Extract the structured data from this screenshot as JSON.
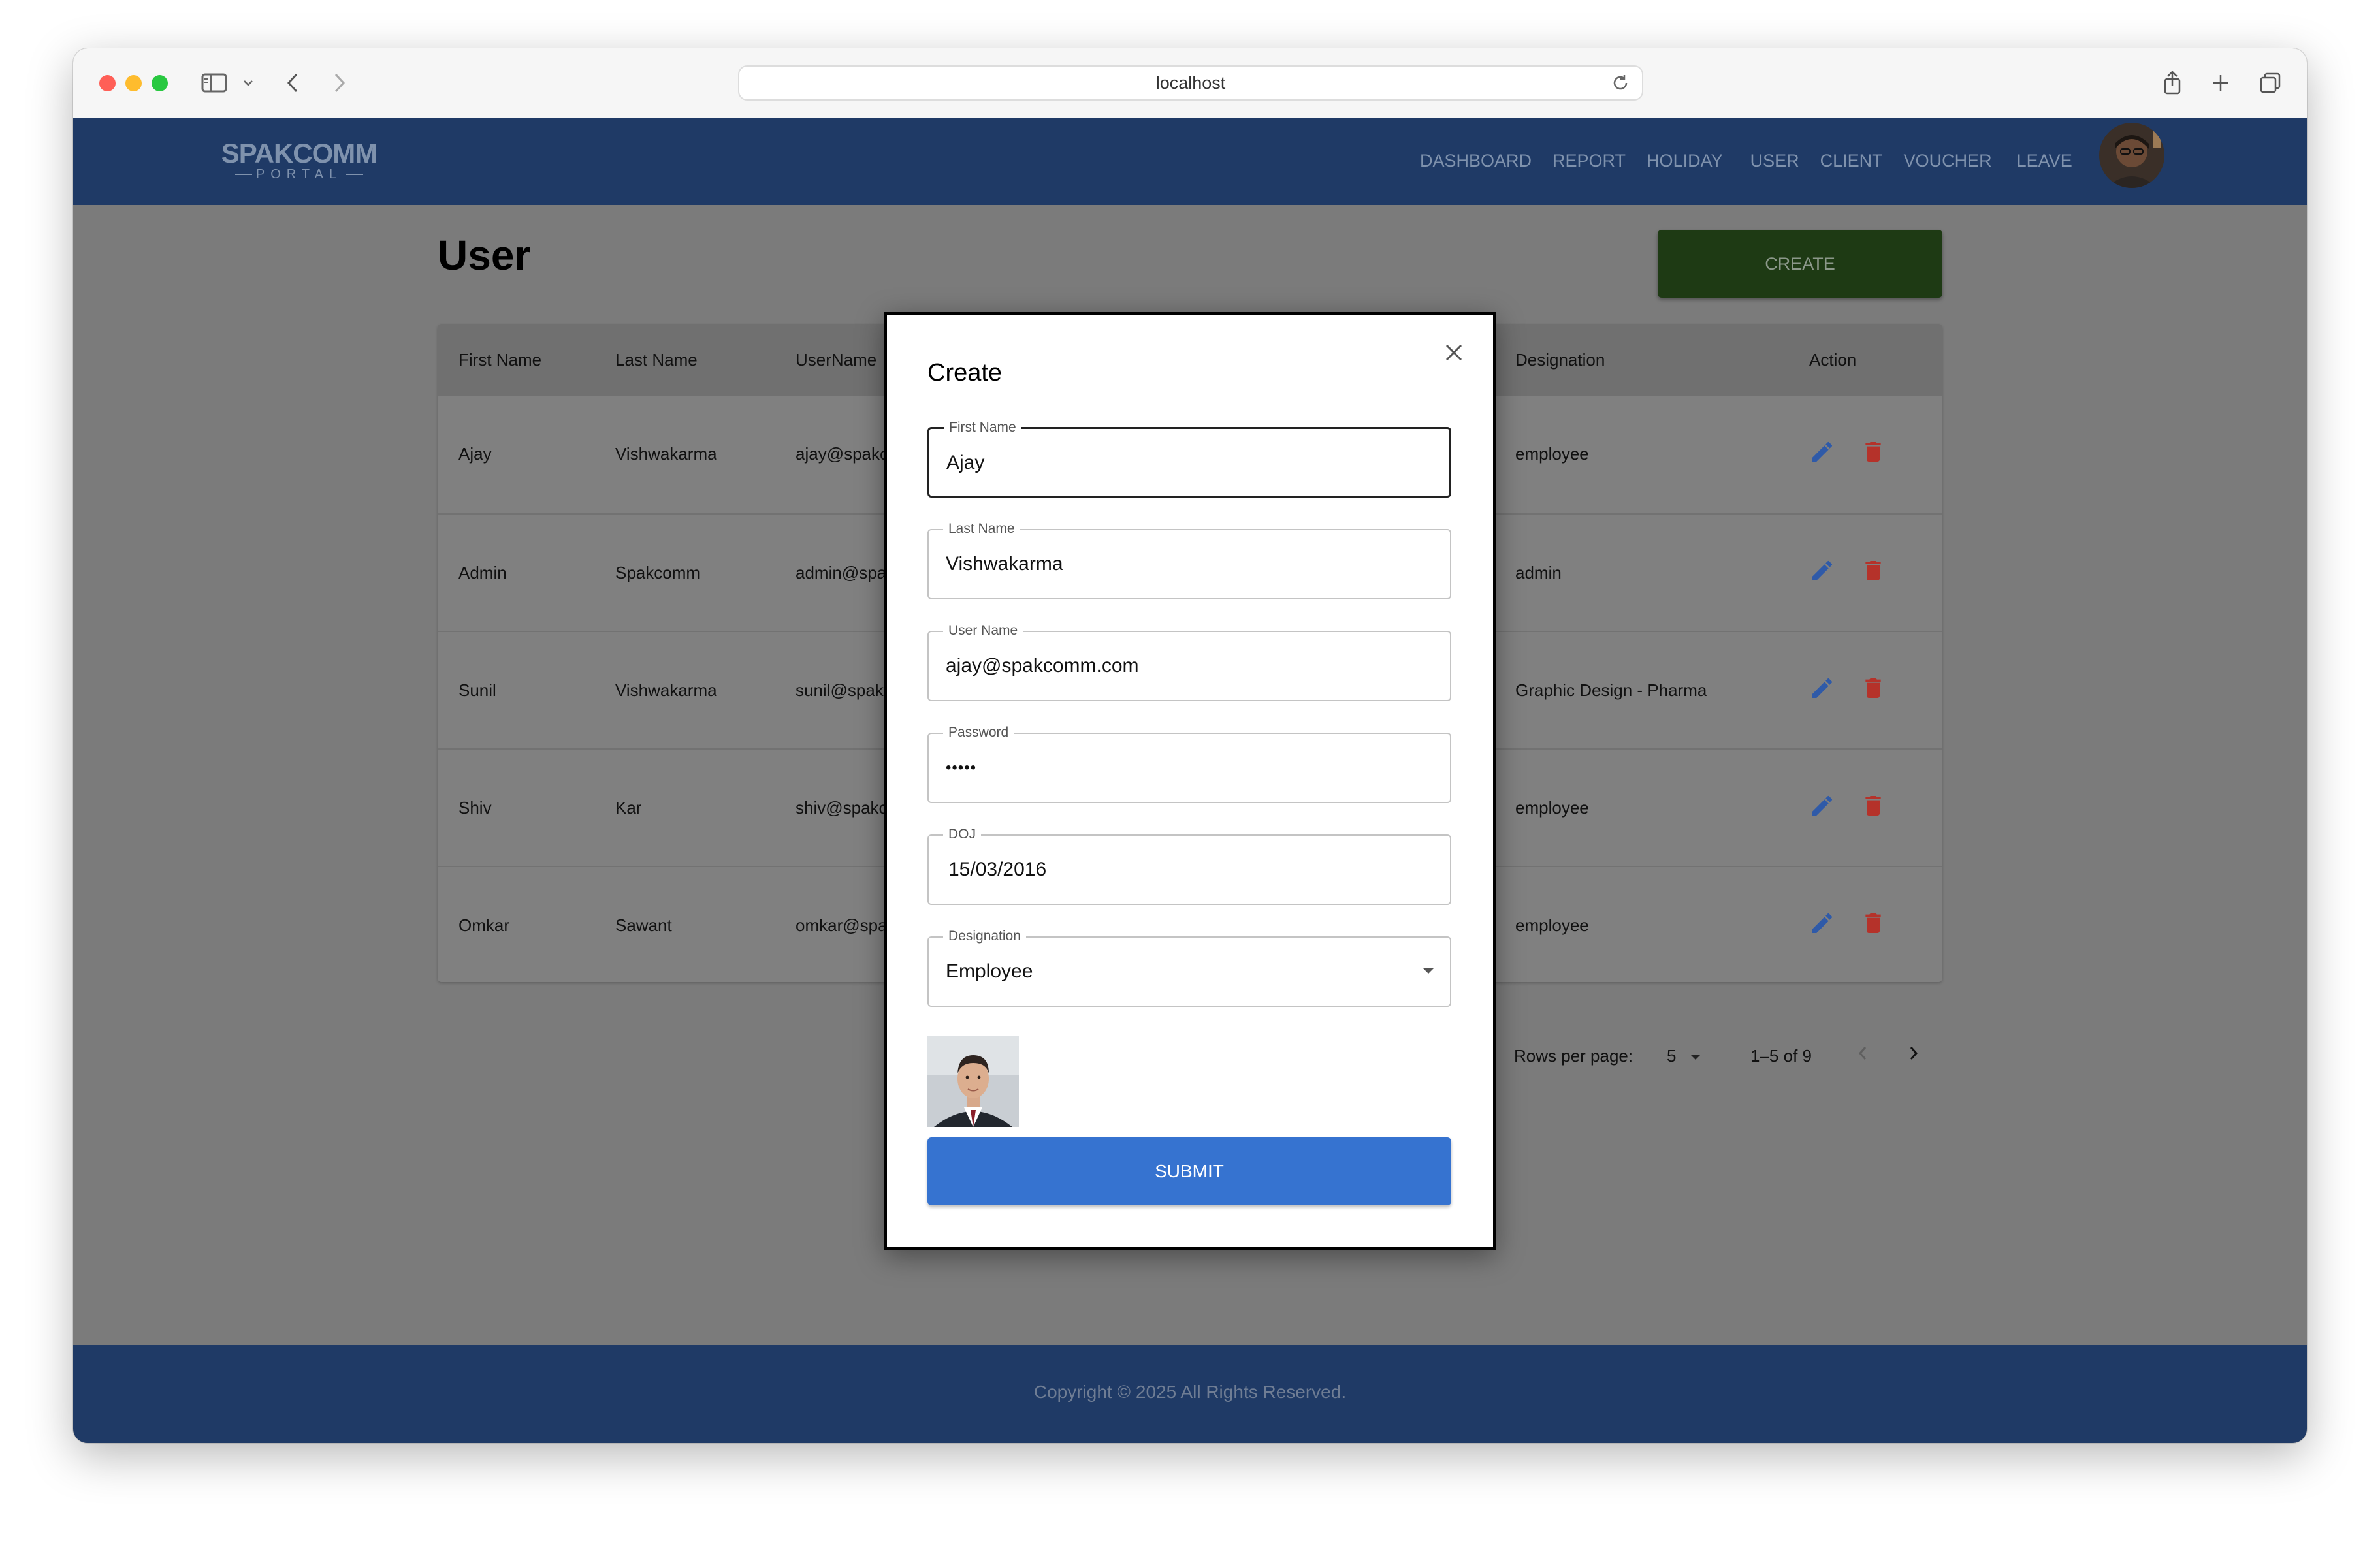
{
  "browser": {
    "url": "localhost"
  },
  "brand": {
    "name": "SPAKCOMM",
    "sub": "PORTAL"
  },
  "nav": {
    "items": [
      "DASHBOARD",
      "REPORT",
      "HOLIDAY",
      "USER",
      "CLIENT",
      "VOUCHER",
      "LEAVE"
    ]
  },
  "page": {
    "title": "User",
    "create_label": "CREATE"
  },
  "table": {
    "headers": [
      "First Name",
      "Last Name",
      "UserName",
      "Designation",
      "Action"
    ],
    "rows": [
      {
        "first": "Ajay",
        "last": "Vishwakarma",
        "username": "ajay@spakc",
        "designation": "employee"
      },
      {
        "first": "Admin",
        "last": "Spakcomm",
        "username": "admin@spa",
        "designation": "admin"
      },
      {
        "first": "Sunil",
        "last": "Vishwakarma",
        "username": "sunil@spak",
        "designation": "Graphic Design - Pharma"
      },
      {
        "first": "Shiv",
        "last": "Kar",
        "username": "shiv@spakc",
        "designation": "employee"
      },
      {
        "first": "Omkar",
        "last": "Sawant",
        "username": "omkar@spa",
        "designation": "employee"
      }
    ]
  },
  "pagination": {
    "rows_label": "Rows per page:",
    "rows_value": "5",
    "range": "1–5 of 9"
  },
  "modal": {
    "title": "Create",
    "fields": [
      {
        "label": "First Name",
        "value": "Ajay"
      },
      {
        "label": "Last Name",
        "value": "Vishwakarma"
      },
      {
        "label": "User Name",
        "value": "ajay@spakcomm.com"
      },
      {
        "label": "Password",
        "value": "•••••"
      },
      {
        "label": "DOJ",
        "value": "15/03/2016"
      },
      {
        "label": "Designation",
        "value": "Employee"
      }
    ],
    "submit_label": "SUBMIT"
  },
  "footer": {
    "text": "Copyright © 2025 All Rights Reserved."
  },
  "colors": {
    "navbar": "#1f3a66",
    "create_button": "#1e3a14",
    "submit_button": "#3673d0",
    "edit_icon": "#2f5aa8",
    "delete_icon": "#b5322a"
  }
}
